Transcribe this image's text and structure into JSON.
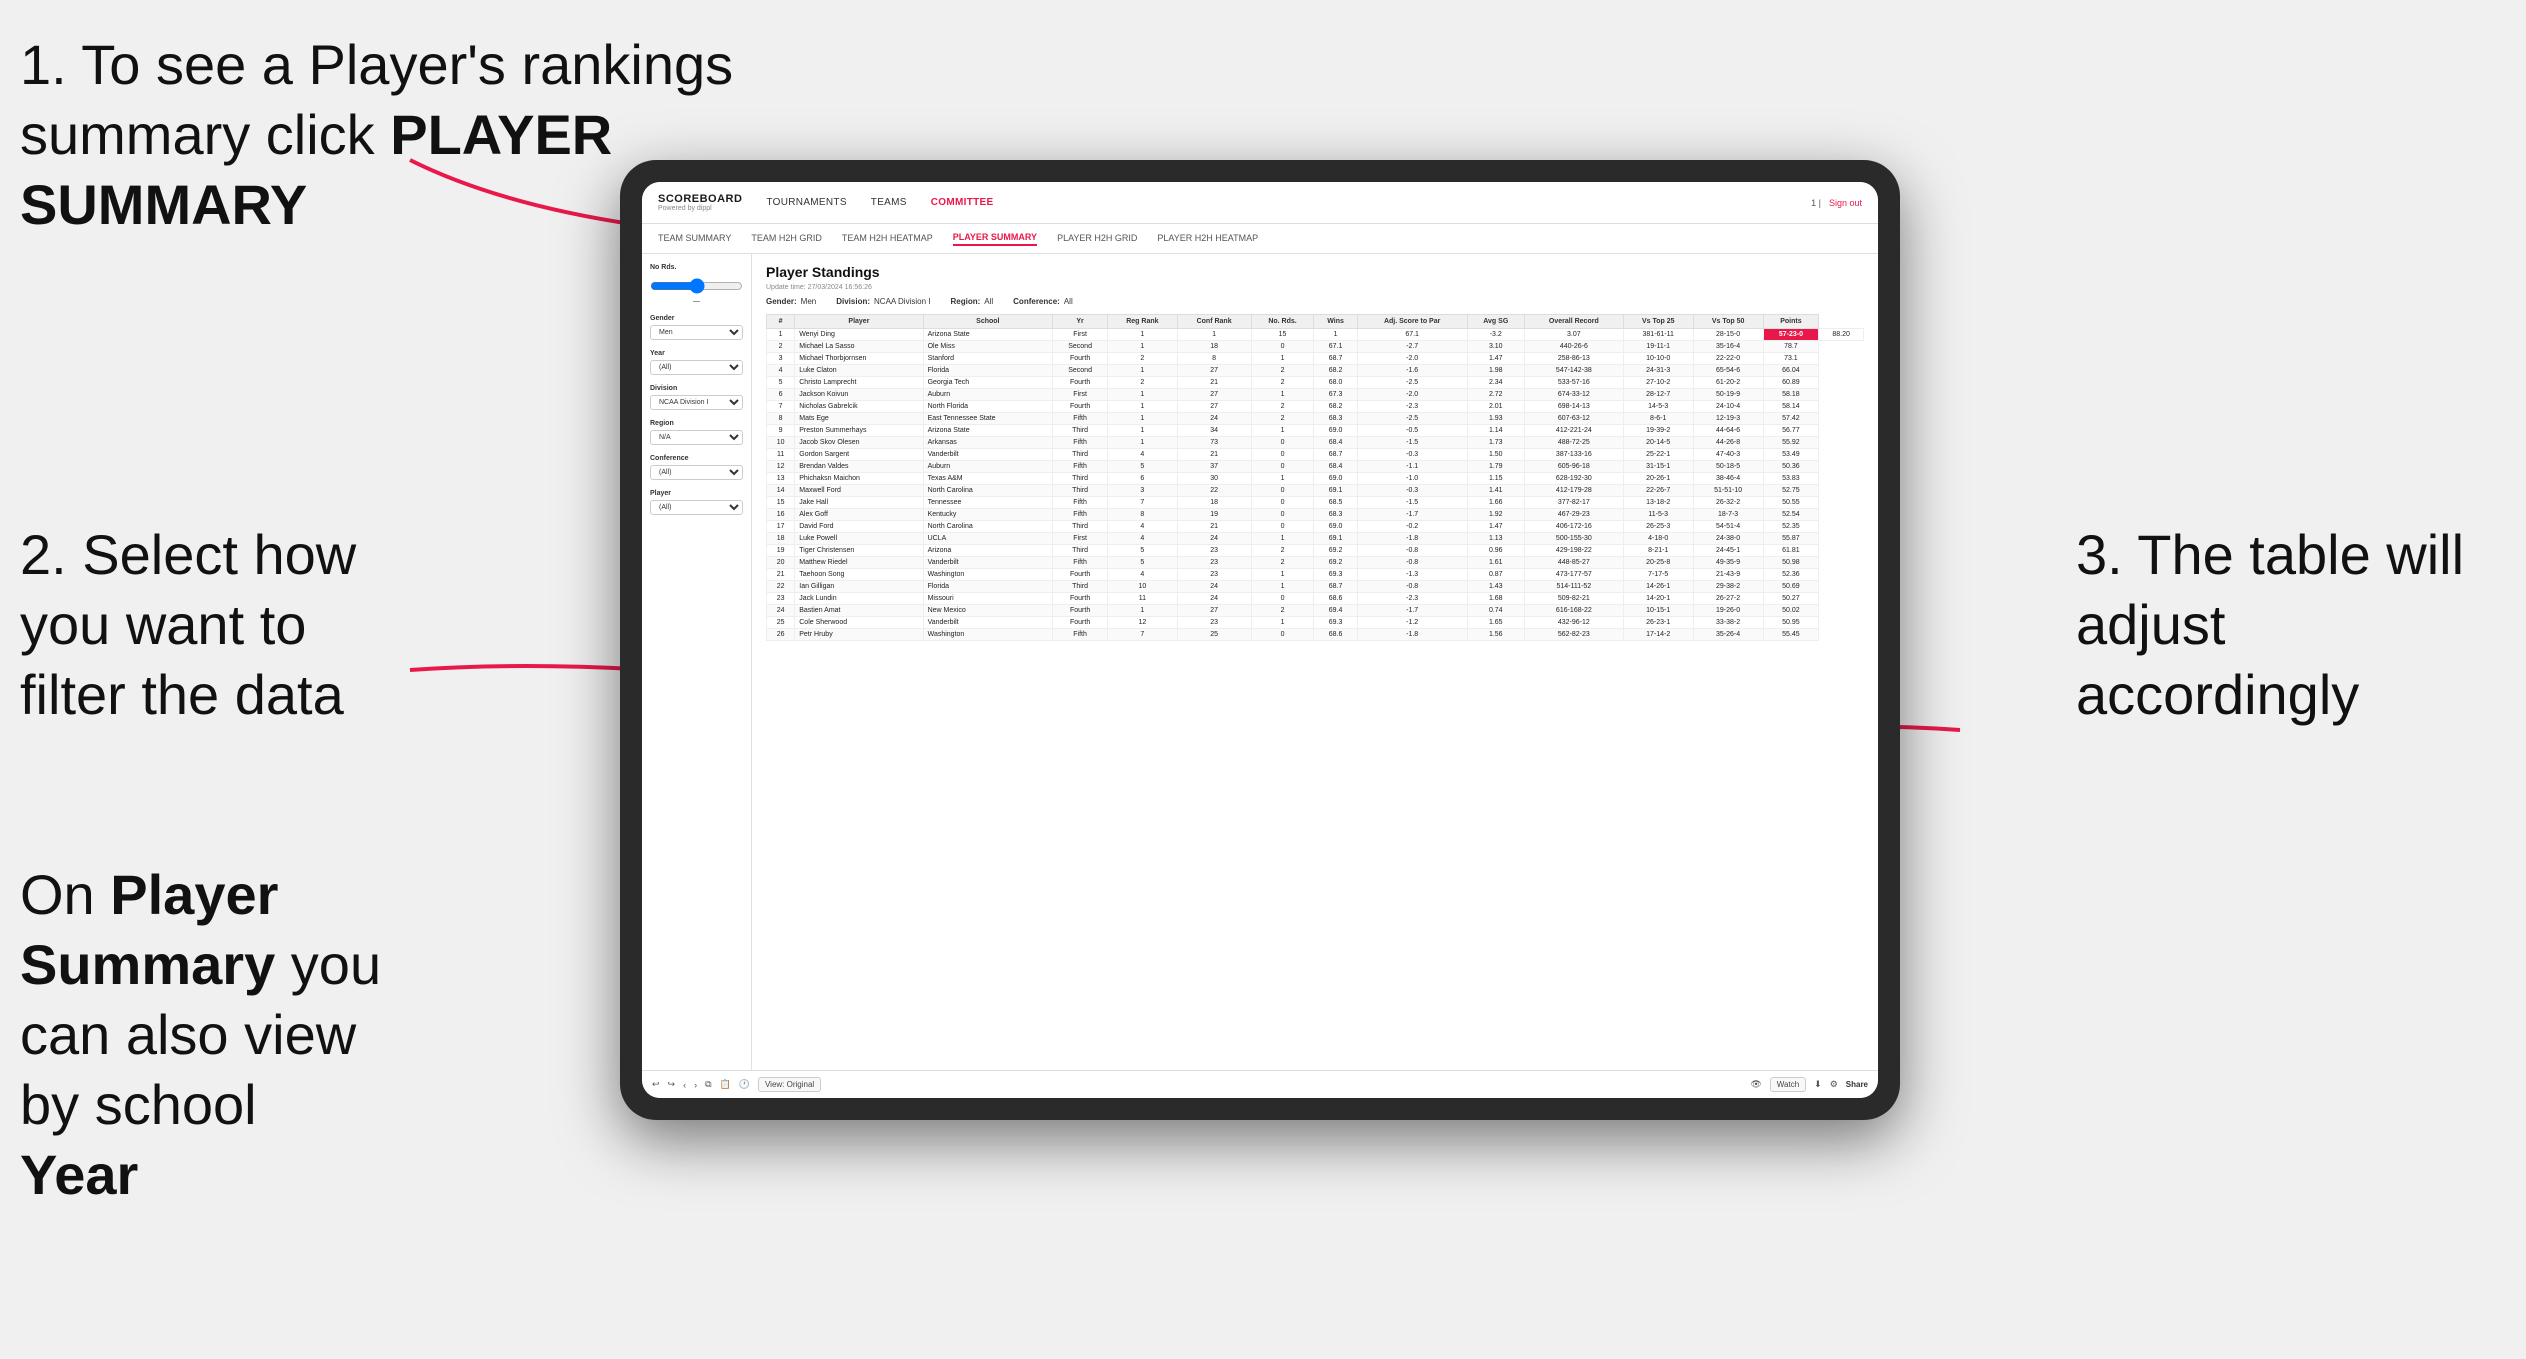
{
  "annotations": {
    "top_left_line1": "1. To see a Player's rankings",
    "top_left_line2": "summary click ",
    "top_left_bold": "PLAYER SUMMARY",
    "middle_left_line1": "2. Select how",
    "middle_left_line2": "you want to",
    "middle_left_line3": "filter the data",
    "bottom_left_line1": "On ",
    "bottom_left_bold1": "Player",
    "bottom_left_line2": "Summary",
    "bottom_left_line3": " you",
    "bottom_left_line4": "can also view",
    "bottom_left_line5": "by school ",
    "bottom_left_bold2": "Year",
    "right_line1": "3. The table will",
    "right_line2": "adjust accordingly"
  },
  "nav": {
    "logo_title": "SCOREBOARD",
    "logo_sub": "Powered by dippl",
    "links": [
      "TOURNAMENTS",
      "TEAMS",
      "COMMITTEE"
    ],
    "active_link": "COMMITTEE",
    "sign_out": "Sign out",
    "page_indicator": "1 |"
  },
  "sub_nav": {
    "links": [
      "TEAM SUMMARY",
      "TEAM H2H GRID",
      "TEAM H2H HEATMAP",
      "PLAYER SUMMARY",
      "PLAYER H2H GRID",
      "PLAYER H2H HEATMAP"
    ],
    "active": "PLAYER SUMMARY"
  },
  "sidebar": {
    "no_rds_label": "No Rds.",
    "gender_label": "Gender",
    "gender_value": "Men",
    "year_label": "Year",
    "year_value": "(All)",
    "division_label": "Division",
    "division_value": "NCAA Division I",
    "region_label": "Region",
    "region_value": "N/A",
    "conference_label": "Conference",
    "conference_value": "(All)",
    "player_label": "Player",
    "player_value": "(All)"
  },
  "table": {
    "title": "Player Standings",
    "update_time": "Update time: 27/03/2024 16:56:26",
    "gender": "Men",
    "division": "NCAA Division I",
    "region": "All",
    "conference": "All",
    "columns": [
      "#",
      "Player",
      "School",
      "Yr",
      "Reg Rank",
      "Conf Rank",
      "No. Rds.",
      "Wins",
      "Adj. Score to Par",
      "Avg SG",
      "Overall Record",
      "Vs Top 25",
      "Vs Top 50",
      "Points"
    ],
    "rows": [
      [
        "1",
        "Wenyi Ding",
        "Arizona State",
        "First",
        "1",
        "1",
        "15",
        "1",
        "67.1",
        "-3.2",
        "3.07",
        "381-61-11",
        "28-15-0",
        "57-23-0",
        "88.20"
      ],
      [
        "2",
        "Michael La Sasso",
        "Ole Miss",
        "Second",
        "1",
        "18",
        "0",
        "67.1",
        "-2.7",
        "3.10",
        "440-26-6",
        "19-11-1",
        "35-16-4",
        "78.7"
      ],
      [
        "3",
        "Michael Thorbjornsen",
        "Stanford",
        "Fourth",
        "2",
        "8",
        "1",
        "68.7",
        "-2.0",
        "1.47",
        "258-86-13",
        "10-10-0",
        "22-22-0",
        "73.1"
      ],
      [
        "4",
        "Luke Claton",
        "Florida",
        "Second",
        "1",
        "27",
        "2",
        "68.2",
        "-1.6",
        "1.98",
        "547-142-38",
        "24-31-3",
        "65-54-6",
        "66.04"
      ],
      [
        "5",
        "Christo Lamprecht",
        "Georgia Tech",
        "Fourth",
        "2",
        "21",
        "2",
        "68.0",
        "-2.5",
        "2.34",
        "533-57-16",
        "27-10-2",
        "61-20-2",
        "60.89"
      ],
      [
        "6",
        "Jackson Koivun",
        "Auburn",
        "First",
        "1",
        "27",
        "1",
        "67.3",
        "-2.0",
        "2.72",
        "674-33-12",
        "28-12-7",
        "50-19-9",
        "58.18"
      ],
      [
        "7",
        "Nicholas Gabrelcik",
        "North Florida",
        "Fourth",
        "1",
        "27",
        "2",
        "68.2",
        "-2.3",
        "2.01",
        "698-14-13",
        "14-5-3",
        "24-10-4",
        "58.14"
      ],
      [
        "8",
        "Mats Ege",
        "East Tennessee State",
        "Fifth",
        "1",
        "24",
        "2",
        "68.3",
        "-2.5",
        "1.93",
        "607-63-12",
        "8-6-1",
        "12-19-3",
        "57.42"
      ],
      [
        "9",
        "Preston Summerhays",
        "Arizona State",
        "Third",
        "1",
        "34",
        "1",
        "69.0",
        "-0.5",
        "1.14",
        "412-221-24",
        "19-39-2",
        "44-64-6",
        "56.77"
      ],
      [
        "10",
        "Jacob Skov Olesen",
        "Arkansas",
        "Fifth",
        "1",
        "73",
        "0",
        "68.4",
        "-1.5",
        "1.73",
        "488-72-25",
        "20-14-5",
        "44-26-8",
        "55.92"
      ],
      [
        "11",
        "Gordon Sargent",
        "Vanderbilt",
        "Third",
        "4",
        "21",
        "0",
        "68.7",
        "-0.3",
        "1.50",
        "387-133-16",
        "25-22-1",
        "47-40-3",
        "53.49"
      ],
      [
        "12",
        "Brendan Valdes",
        "Auburn",
        "Fifth",
        "5",
        "37",
        "0",
        "68.4",
        "-1.1",
        "1.79",
        "605-96-18",
        "31-15-1",
        "50-18-5",
        "50.36"
      ],
      [
        "13",
        "Phichaksn Maichon",
        "Texas A&M",
        "Third",
        "6",
        "30",
        "1",
        "69.0",
        "-1.0",
        "1.15",
        "628-192-30",
        "20-26-1",
        "38-46-4",
        "53.83"
      ],
      [
        "14",
        "Maxwell Ford",
        "North Carolina",
        "Third",
        "3",
        "22",
        "0",
        "69.1",
        "-0.3",
        "1.41",
        "412-179-28",
        "22-26-7",
        "51-51-10",
        "52.75"
      ],
      [
        "15",
        "Jake Hall",
        "Tennessee",
        "Fifth",
        "7",
        "18",
        "0",
        "68.5",
        "-1.5",
        "1.66",
        "377-82-17",
        "13-18-2",
        "26-32-2",
        "50.55"
      ],
      [
        "16",
        "Alex Goff",
        "Kentucky",
        "Fifth",
        "8",
        "19",
        "0",
        "68.3",
        "-1.7",
        "1.92",
        "467-29-23",
        "11-5-3",
        "18-7-3",
        "52.54"
      ],
      [
        "17",
        "David Ford",
        "North Carolina",
        "Third",
        "4",
        "21",
        "0",
        "69.0",
        "-0.2",
        "1.47",
        "406-172-16",
        "26-25-3",
        "54-51-4",
        "52.35"
      ],
      [
        "18",
        "Luke Powell",
        "UCLA",
        "First",
        "4",
        "24",
        "1",
        "69.1",
        "-1.8",
        "1.13",
        "500-155-30",
        "4-18-0",
        "24-38-0",
        "55.87"
      ],
      [
        "19",
        "Tiger Christensen",
        "Arizona",
        "Third",
        "5",
        "23",
        "2",
        "69.2",
        "-0.8",
        "0.96",
        "429-198-22",
        "8-21-1",
        "24-45-1",
        "61.81"
      ],
      [
        "20",
        "Matthew Riedel",
        "Vanderbilt",
        "Fifth",
        "5",
        "23",
        "2",
        "69.2",
        "-0.8",
        "1.61",
        "448-85-27",
        "20-25-8",
        "49-35-9",
        "50.98"
      ],
      [
        "21",
        "Taehoon Song",
        "Washington",
        "Fourth",
        "4",
        "23",
        "1",
        "69.3",
        "-1.3",
        "0.87",
        "473-177-57",
        "7-17-5",
        "21-43-9",
        "52.36"
      ],
      [
        "22",
        "Ian Gilligan",
        "Florida",
        "Third",
        "10",
        "24",
        "1",
        "68.7",
        "-0.8",
        "1.43",
        "514-111-52",
        "14-26-1",
        "29-38-2",
        "50.69"
      ],
      [
        "23",
        "Jack Lundin",
        "Missouri",
        "Fourth",
        "11",
        "24",
        "0",
        "68.6",
        "-2.3",
        "1.68",
        "509-82-21",
        "14-20-1",
        "26-27-2",
        "50.27"
      ],
      [
        "24",
        "Bastien Amat",
        "New Mexico",
        "Fourth",
        "1",
        "27",
        "2",
        "69.4",
        "-1.7",
        "0.74",
        "616-168-22",
        "10-15-1",
        "19-26-0",
        "50.02"
      ],
      [
        "25",
        "Cole Sherwood",
        "Vanderbilt",
        "Fourth",
        "12",
        "23",
        "1",
        "69.3",
        "-1.2",
        "1.65",
        "432-96-12",
        "26-23-1",
        "33-38-2",
        "50.95"
      ],
      [
        "26",
        "Petr Hruby",
        "Washington",
        "Fifth",
        "7",
        "25",
        "0",
        "68.6",
        "-1.8",
        "1.56",
        "562-82-23",
        "17-14-2",
        "35-26-4",
        "55.45"
      ]
    ]
  },
  "toolbar": {
    "view_label": "View: Original",
    "watch_label": "Watch",
    "share_label": "Share"
  }
}
